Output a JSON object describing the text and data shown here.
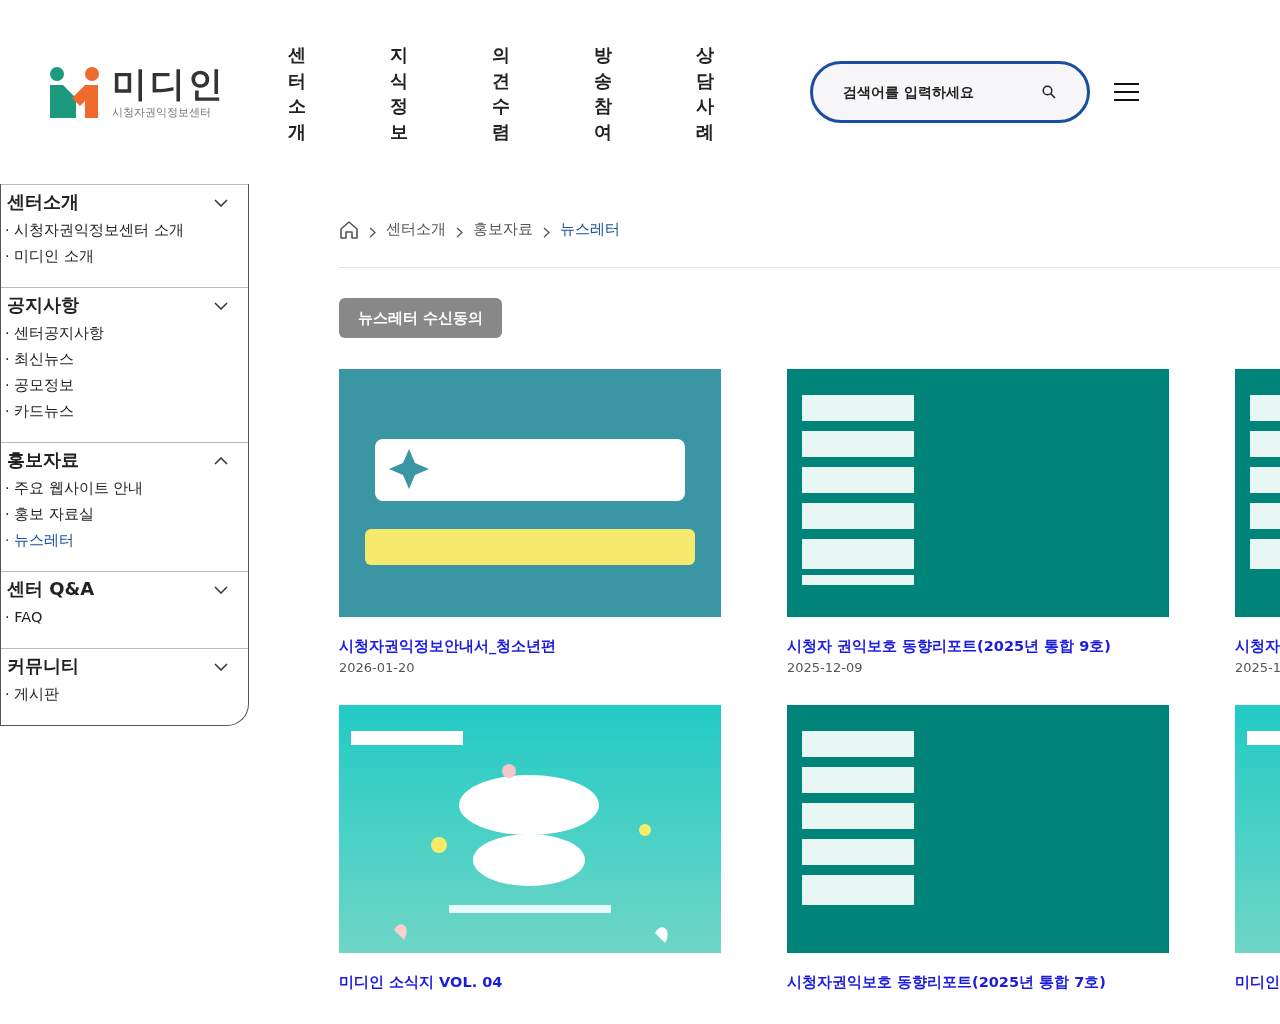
{
  "header": {
    "logo": {
      "name": "미디인",
      "subtitle": "시청자권익정보센터"
    },
    "nav": [
      "센터소개",
      "지식정보",
      "의견수렴",
      "방송참여",
      "상담사례"
    ],
    "search": {
      "placeholder": "검색어를 입력하세요"
    }
  },
  "sidebar": {
    "sections": [
      {
        "title": "센터소개",
        "expanded": false,
        "items": [
          {
            "label": "· 시청자권익정보센터 소개",
            "selected": false
          },
          {
            "label": "· 미디인 소개",
            "selected": false
          }
        ]
      },
      {
        "title": "공지사항",
        "expanded": false,
        "items": [
          {
            "label": "· 센터공지사항",
            "selected": false
          },
          {
            "label": "· 최신뉴스",
            "selected": false
          },
          {
            "label": "· 공모정보",
            "selected": false
          },
          {
            "label": "· 카드뉴스",
            "selected": false
          }
        ]
      },
      {
        "title": "홍보자료",
        "expanded": true,
        "items": [
          {
            "label": "· 주요 웹사이트 안내",
            "selected": false
          },
          {
            "label": "· 홍보 자료실",
            "selected": false
          },
          {
            "label": "· 뉴스레터",
            "selected": true
          }
        ]
      },
      {
        "title": "센터 Q&A",
        "expanded": false,
        "items": [
          {
            "label": "· FAQ",
            "selected": false
          }
        ]
      },
      {
        "title": "커뮤니티",
        "expanded": false,
        "items": [
          {
            "label": "· 게시판",
            "selected": false
          }
        ]
      }
    ]
  },
  "breadcrumb": [
    {
      "label": "센터소개",
      "selected": false
    },
    {
      "label": "홍보자료",
      "selected": false
    },
    {
      "label": "뉴스레터",
      "selected": true
    }
  ],
  "subscribe_button": "뉴스레터 수신동의",
  "cards": [
    {
      "title": "시청자권익정보안내서_청소년편",
      "date": "2026-01-20"
    },
    {
      "title": "시청자 권익보호 동향리포트(2025년 통합 9호)",
      "date": "2025-12-09"
    },
    {
      "title": "시청자",
      "date": "2025-1"
    },
    {
      "title": "미디인 소식지 VOL. 04"
    },
    {
      "title": "시청자권익보호 동향리포트(2025년 통합 7호)"
    },
    {
      "title": "미디인"
    }
  ]
}
